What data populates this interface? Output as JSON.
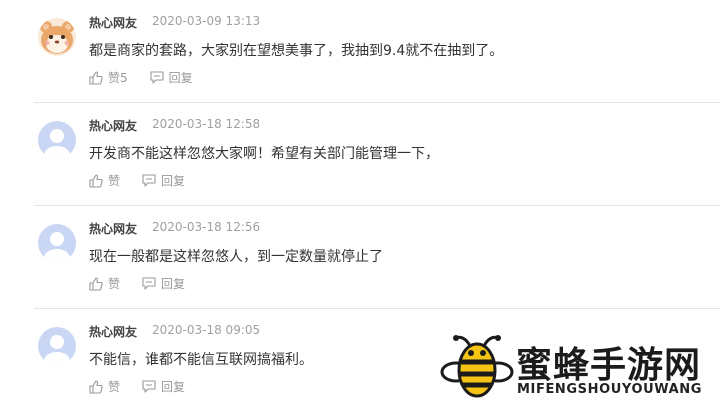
{
  "comments": [
    {
      "avatar": "cartoon-hamster-avatar",
      "name": "热心网友",
      "time": "2020-03-09 13:13",
      "text": "都是商家的套路，大家别在望想美事了，我抽到9.4就不在抽到了。",
      "like_label": "赞5",
      "reply_label": "回复"
    },
    {
      "avatar": "default-user-avatar",
      "name": "热心网友",
      "time": "2020-03-18 12:58",
      "text": "开发商不能这样忽悠大家啊！希望有关部门能管理一下，",
      "like_label": "赞",
      "reply_label": "回复"
    },
    {
      "avatar": "default-user-avatar",
      "name": "热心网友",
      "time": "2020-03-18 12:56",
      "text": "现在一般都是这样忽悠人，到一定数量就停止了",
      "like_label": "赞",
      "reply_label": "回复"
    },
    {
      "avatar": "default-user-avatar",
      "name": "热心网友",
      "time": "2020-03-18 09:05",
      "text": "不能信，谁都不能信互联网搞福利。",
      "like_label": "赞",
      "reply_label": "回复"
    }
  ],
  "watermark": {
    "title": "蜜蜂手游网",
    "subtitle": "MIFENGSHOUYOUWANG",
    "logo": "bee-logo"
  },
  "colors": {
    "meta": "#a0a0a0",
    "action": "#999999",
    "avatar_default": "#c9d7f5",
    "divider": "#e6e6e6"
  }
}
